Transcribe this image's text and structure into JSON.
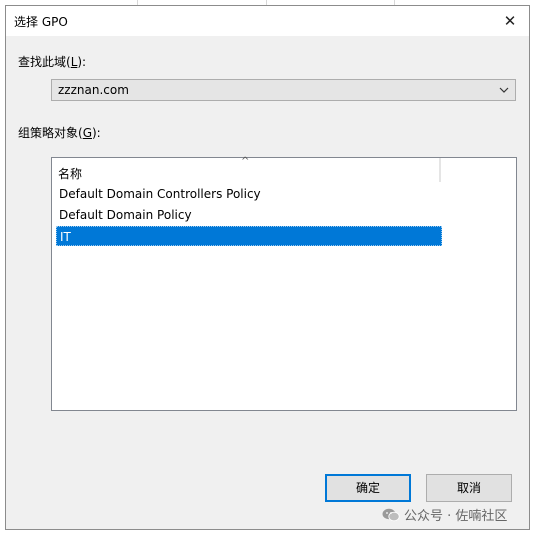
{
  "window": {
    "title": "选择 GPO"
  },
  "domain_lookup": {
    "label": "查找此域(",
    "mnemonic": "L",
    "label_end": "):",
    "value": "zzznan.com"
  },
  "gpo_objects": {
    "label": "组策略对象(",
    "mnemonic": "G",
    "label_end": "):"
  },
  "list": {
    "column_header": "名称",
    "items": [
      {
        "name": "Default Domain Controllers Policy",
        "selected": false
      },
      {
        "name": "Default Domain Policy",
        "selected": false
      },
      {
        "name": "IT",
        "selected": true
      }
    ]
  },
  "buttons": {
    "ok": "确定",
    "cancel": "取消"
  },
  "watermark": {
    "text": "公众号 · 佐喃社区",
    "icon": "wechat-icon"
  },
  "colors": {
    "selection": "#0078d7",
    "dialog_bg": "#f0f0f0",
    "default_button_border": "#0078d7"
  }
}
